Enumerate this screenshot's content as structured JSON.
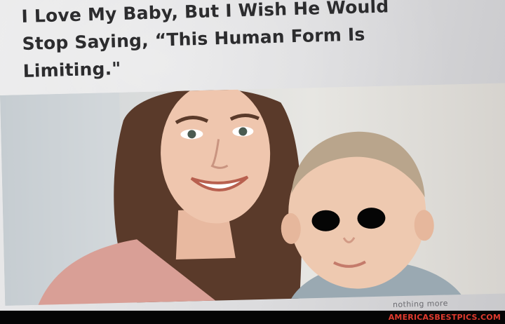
{
  "article": {
    "headline_line1": "I Love My Baby, But I Wish He Would",
    "headline_line2": "Stop Saying, “This Human Form Is",
    "headline_line3": "Limiting.\"",
    "read_more": "nothing more"
  },
  "footer": {
    "watermark": "AMERICASBESTPICS.COM"
  },
  "colors": {
    "headline": "#2c2c2e",
    "watermark": "#e03a2e"
  }
}
